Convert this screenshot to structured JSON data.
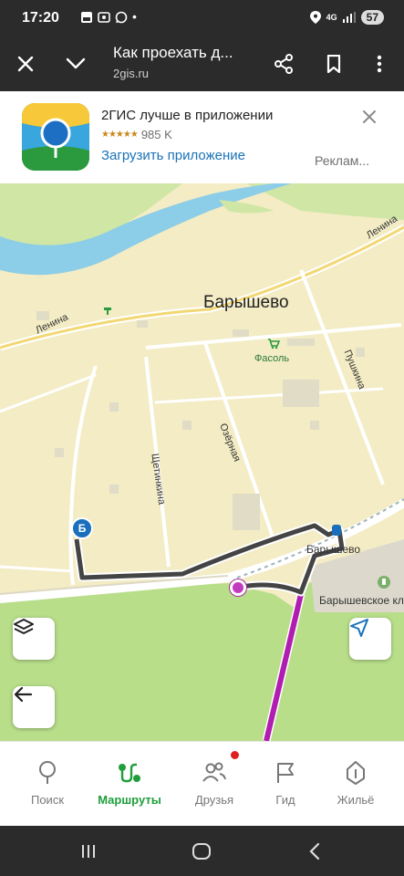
{
  "status_bar": {
    "time": "17:20",
    "network": "4G",
    "battery": "57"
  },
  "header": {
    "title": "Как проехать д...",
    "url": "2gis.ru"
  },
  "ad": {
    "title": "2ГИС лучше в приложении",
    "reviews": "985 K",
    "cta": "Загрузить приложение",
    "label": "Реклам..."
  },
  "map": {
    "city": "Барышево",
    "streets": {
      "lenina_left": "Ленина",
      "lenina_right": "Ленина",
      "pushkina": "Пушкина",
      "ozernaya": "Озёрная",
      "shchetinkina": "Щетинкина"
    },
    "poi": {
      "fasol": "Фасоль",
      "station": "Барышево",
      "cemetery": "Барышевское кл"
    },
    "marker_b": "Б"
  },
  "nav": {
    "items": [
      {
        "label": "Поиск",
        "icon": "search-pin-icon"
      },
      {
        "label": "Маршруты",
        "icon": "routes-icon"
      },
      {
        "label": "Друзья",
        "icon": "friends-icon"
      },
      {
        "label": "Гид",
        "icon": "flag-icon"
      },
      {
        "label": "Жильё",
        "icon": "housing-icon"
      }
    ],
    "active_index": 1
  },
  "colors": {
    "route_transit": "#b11db0",
    "route_walk": "#444444",
    "accent_green": "#1f9e3b",
    "link_blue": "#1a73b8"
  }
}
